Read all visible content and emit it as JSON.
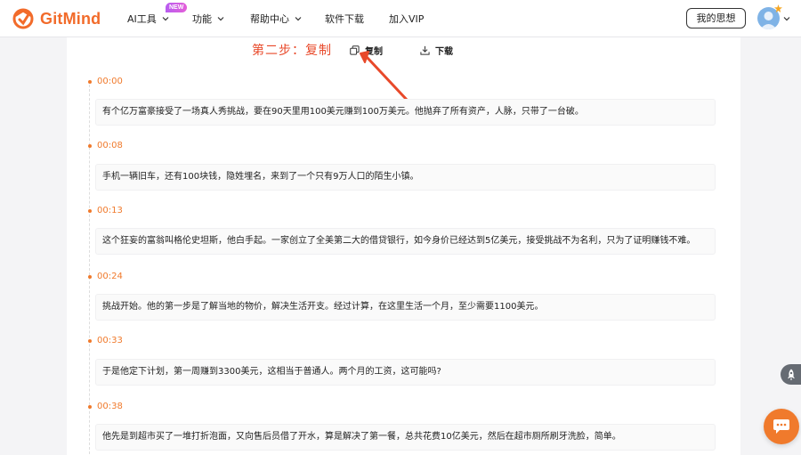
{
  "brand": {
    "name": "GitMind",
    "accent": "#f26b2a"
  },
  "nav": {
    "items": [
      {
        "label": "AI工具",
        "has_dropdown": true
      },
      {
        "label": "功能",
        "has_dropdown": true
      },
      {
        "label": "帮助中心",
        "has_dropdown": true
      },
      {
        "label": "软件下载",
        "has_dropdown": false
      },
      {
        "label": "加入VIP",
        "has_dropdown": false
      }
    ],
    "new_badge": "NEW",
    "my_ideas_label": "我的思想"
  },
  "toolbar": {
    "step_label": "第二步：复制",
    "copy_label": "复制",
    "download_label": "下载"
  },
  "transcript": [
    {
      "time": "00:00",
      "text": "有个亿万富豪接受了一场真人秀挑战，要在90天里用100美元赚到100万美元。他抛弃了所有资产，人脉，只带了一台破。"
    },
    {
      "time": "00:08",
      "text": "手机一辆旧车，还有100块钱，隐姓埋名，来到了一个只有9万人口的陌生小镇。"
    },
    {
      "time": "00:13",
      "text": "这个狂妄的富翁叫格伦史坦斯，他白手起。一家创立了全美第二大的借贷银行，如今身价已经达到5亿美元，接受挑战不为名利，只为了证明赚钱不难。"
    },
    {
      "time": "00:24",
      "text": "挑战开始。他的第一步是了解当地的物价，解决生活开支。经过计算，在这里生活一个月，至少需要1100美元。"
    },
    {
      "time": "00:33",
      "text": "于是他定下计划，第一周赚到3300美元，这相当于普通人。两个月的工资，这可能吗?"
    },
    {
      "time": "00:38",
      "text": "他先是到超市买了一堆打折泡面，又向售后员借了开水，算是解决了第一餐，总共花费10亿美元，然后在超市厕所刷牙洗脸，简单。"
    }
  ],
  "icons": {
    "logo": "gitmind-logo-icon",
    "copy": "copy-icon",
    "download": "download-icon",
    "rocket": "rocket-icon",
    "chat": "chat-icon"
  }
}
